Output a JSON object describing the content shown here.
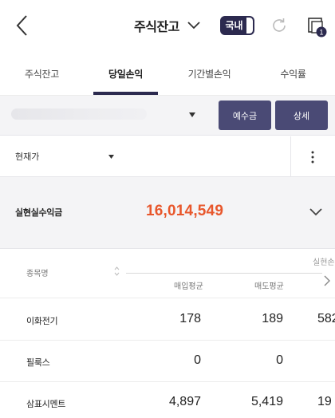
{
  "header": {
    "title": "주식잔고",
    "market_toggle_label": "국내",
    "notification_count": "1"
  },
  "tabs": [
    {
      "label": "주식잔고",
      "active": false
    },
    {
      "label": "당일손익",
      "active": true
    },
    {
      "label": "기간별손익",
      "active": false
    },
    {
      "label": "수익률",
      "active": false
    }
  ],
  "account": {
    "deposit_label": "예수금",
    "detail_label": "상세"
  },
  "price_type": {
    "selected": "현재가"
  },
  "summary": {
    "label": "실현실수익금",
    "value": "16,014,549"
  },
  "table": {
    "columns": {
      "name": "종목명",
      "buy_avg": "매입평균",
      "sell_avg": "매도평균",
      "realized": "실현손"
    },
    "rows": [
      {
        "name": "이화전기",
        "buy_avg": "178",
        "sell_avg": "189",
        "realized": "582"
      },
      {
        "name": "필룩스",
        "buy_avg": "0",
        "sell_avg": "0",
        "realized": ""
      },
      {
        "name": "삼표시멘트",
        "buy_avg": "4,897",
        "sell_avg": "5,419",
        "realized": "19"
      }
    ]
  },
  "colors": {
    "accent_navy": "#2c2a4f",
    "button_bg": "#4a4a75",
    "profit_orange": "#e8572c"
  }
}
